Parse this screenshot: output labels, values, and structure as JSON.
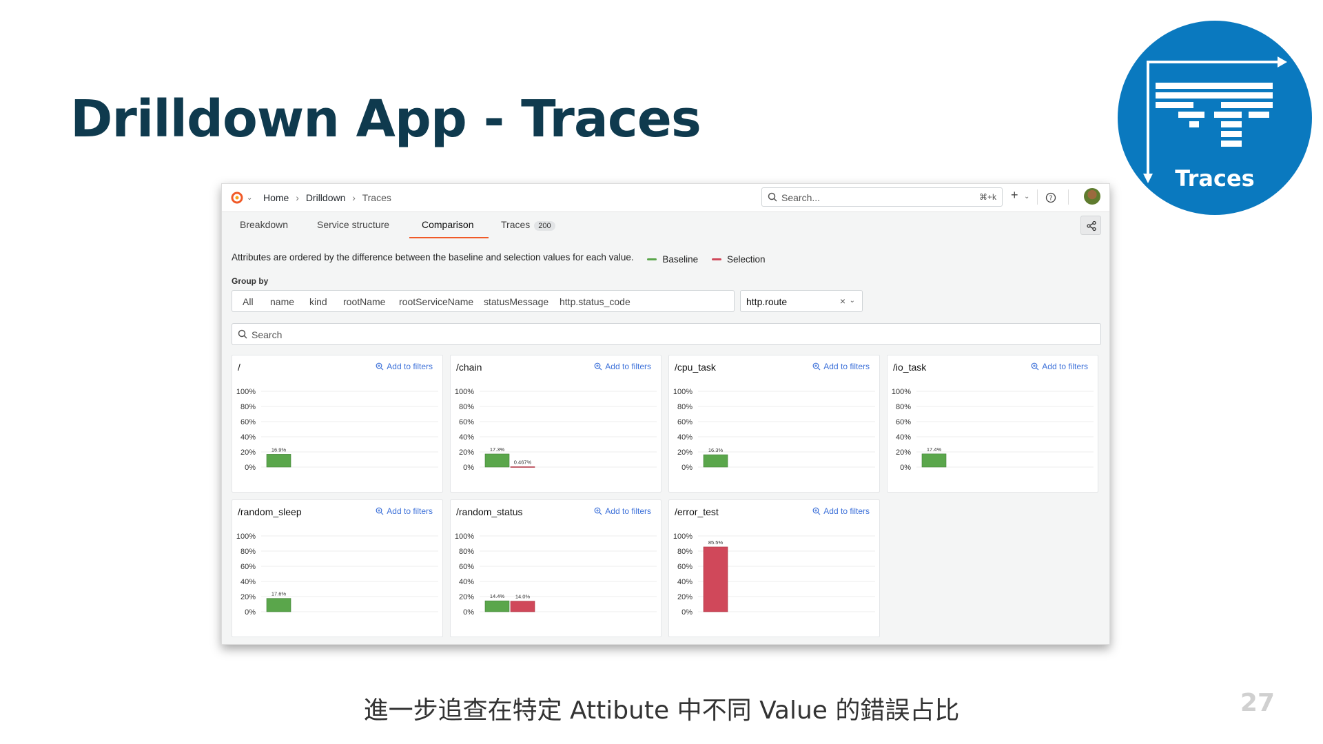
{
  "slide": {
    "title": "Drilldown App - Traces",
    "caption": "進一步追查在特定 Attibute 中不同 Value 的錯誤占比",
    "page_number": "27",
    "logo_label": "Traces"
  },
  "app": {
    "breadcrumbs": [
      "Home",
      "Drilldown",
      "Traces"
    ],
    "search_placeholder": "Search...",
    "search_shortcut": "⌘+k",
    "tabs": [
      {
        "label": "Breakdown"
      },
      {
        "label": "Service structure"
      },
      {
        "label": "Comparison",
        "active": true
      },
      {
        "label": "Traces",
        "badge": "200"
      }
    ],
    "description": "Attributes are ordered by the difference between the baseline and selection values for each value.",
    "legend": [
      {
        "label": "Baseline",
        "color": "#5aa64b"
      },
      {
        "label": "Selection",
        "color": "#d0485a"
      }
    ],
    "group_by_label": "Group by",
    "group_options": [
      "All",
      "name",
      "kind",
      "rootName",
      "rootServiceName",
      "statusMessage",
      "http.status_code"
    ],
    "group_selected": "http.route",
    "filter_search_placeholder": "Search",
    "add_to_filters_label": "Add to filters",
    "y_ticks": [
      "100%",
      "80%",
      "60%",
      "40%",
      "20%",
      "0%"
    ],
    "colors": {
      "baseline": "#5aa64b",
      "selection": "#d0485a",
      "accent": "#f05a28",
      "link": "#3d71d9"
    }
  },
  "chart_data": [
    {
      "type": "bar",
      "title": "/",
      "categories": [
        "Baseline"
      ],
      "values": [
        16.9
      ],
      "value_labels": [
        "16.9%"
      ],
      "ylim": [
        0,
        100
      ]
    },
    {
      "type": "bar",
      "title": "/chain",
      "categories": [
        "Baseline",
        "Selection"
      ],
      "values": [
        17.3,
        0.467
      ],
      "value_labels": [
        "17.3%",
        "0.467%"
      ],
      "ylim": [
        0,
        100
      ]
    },
    {
      "type": "bar",
      "title": "/cpu_task",
      "categories": [
        "Baseline"
      ],
      "values": [
        16.3
      ],
      "value_labels": [
        "16.3%"
      ],
      "ylim": [
        0,
        100
      ]
    },
    {
      "type": "bar",
      "title": "/io_task",
      "categories": [
        "Baseline"
      ],
      "values": [
        17.4
      ],
      "value_labels": [
        "17.4%"
      ],
      "ylim": [
        0,
        100
      ]
    },
    {
      "type": "bar",
      "title": "/random_sleep",
      "categories": [
        "Baseline"
      ],
      "values": [
        17.6
      ],
      "value_labels": [
        "17.6%"
      ],
      "ylim": [
        0,
        100
      ]
    },
    {
      "type": "bar",
      "title": "/random_status",
      "categories": [
        "Baseline",
        "Selection"
      ],
      "values": [
        14.4,
        14.0
      ],
      "value_labels": [
        "14.4%",
        "14.0%"
      ],
      "ylim": [
        0,
        100
      ]
    },
    {
      "type": "bar",
      "title": "/error_test",
      "categories": [
        "Selection"
      ],
      "values": [
        85.5
      ],
      "value_labels": [
        "85.5%"
      ],
      "ylim": [
        0,
        100
      ]
    }
  ]
}
